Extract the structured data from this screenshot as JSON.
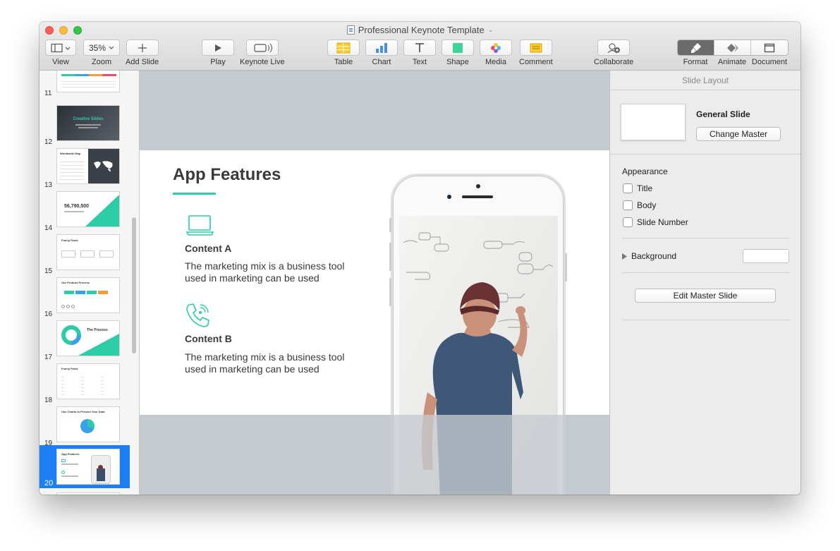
{
  "window": {
    "title": "Professional Keynote Template"
  },
  "toolbar": {
    "view_label": "View",
    "zoom_value": "35%",
    "zoom_label": "Zoom",
    "add_slide_label": "Add Slide",
    "play_label": "Play",
    "keynote_live_label": "Keynote Live",
    "table_label": "Table",
    "chart_label": "Chart",
    "text_label": "Text",
    "shape_label": "Shape",
    "media_label": "Media",
    "comment_label": "Comment",
    "collaborate_label": "Collaborate",
    "format_label": "Format",
    "animate_label": "Animate",
    "document_label": "Document"
  },
  "sidebar": {
    "slides": [
      {
        "number": "11"
      },
      {
        "number": "12",
        "thumb_title": "Creative Slides"
      },
      {
        "number": "13",
        "thumb_title": "Worldwide Map"
      },
      {
        "number": "14",
        "thumb_title": "56,790,500"
      },
      {
        "number": "15",
        "thumb_title": "Funny Facts"
      },
      {
        "number": "16",
        "thumb_title": "Our Product Process"
      },
      {
        "number": "17",
        "thumb_title": "The Process"
      },
      {
        "number": "18",
        "thumb_title": "Funny Facts"
      },
      {
        "number": "19",
        "thumb_title": "Use Charts to Present Your Data"
      },
      {
        "number": "20",
        "thumb_title": "App Features"
      }
    ],
    "selected_index": 9
  },
  "slide": {
    "title": "App Features",
    "items": [
      {
        "heading": "Content A",
        "body": "The marketing mix is a business tool used in marketing can be used"
      },
      {
        "heading": "Content B",
        "body": "The marketing mix is a business tool used in marketing can be used"
      }
    ],
    "accent_color": "#2ecba7"
  },
  "inspector": {
    "header": "Slide Layout",
    "master_name": "General Slide",
    "change_master_label": "Change Master",
    "appearance_label": "Appearance",
    "checkboxes": [
      {
        "label": "Title",
        "checked": false
      },
      {
        "label": "Body",
        "checked": false
      },
      {
        "label": "Slide Number",
        "checked": false
      }
    ],
    "background_label": "Background",
    "edit_master_label": "Edit Master Slide"
  },
  "icons": {
    "table": "table-icon",
    "chart": "chart-icon",
    "text": "text-icon",
    "shape": "shape-icon",
    "media": "media-icon",
    "comment": "comment-icon",
    "collaborate": "collaborate-icon",
    "format": "paintbrush-icon",
    "animate": "animate-icon",
    "document": "document-icon",
    "laptop": "laptop-icon",
    "phone_call": "phone-call-icon"
  }
}
